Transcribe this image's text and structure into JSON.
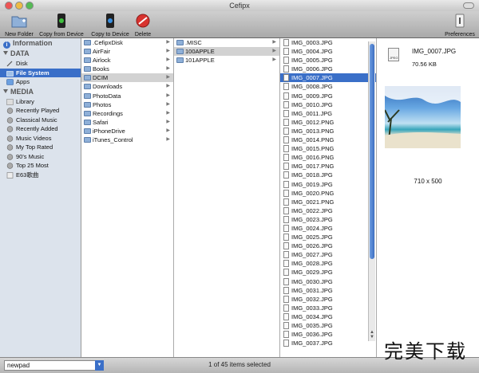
{
  "window": {
    "title": "Cefipx"
  },
  "toolbar": {
    "new_folder": "New Folder",
    "copy_from_device": "Copy from Device",
    "copy_to_device": "Copy to Device",
    "delete": "Delete",
    "preferences": "Preferences"
  },
  "sidebar": {
    "information": "Information",
    "data_header": "DATA",
    "data_items": [
      "Disk",
      "File System",
      "Apps"
    ],
    "media_header": "MEDIA",
    "media_items": [
      "Library",
      "Recently Played",
      "Classical Music",
      "Recently Added",
      "Music Videos",
      "My Top Rated",
      "90's Music",
      "Top 25 Most",
      "E63歌曲"
    ]
  },
  "columns": {
    "col1": [
      ".CefipxDisk",
      "AirFair",
      "Airlock",
      "Books",
      "DCIM",
      "Downloads",
      "PhotoData",
      "Photos",
      "Recordings",
      "Safari",
      "iPhoneDrive",
      "iTunes_Control"
    ],
    "col2": [
      ".MISC",
      "100APPLE",
      "101APPLE"
    ],
    "col3": [
      "IMG_0003.JPG",
      "IMG_0004.JPG",
      "IMG_0005.JPG",
      "IMG_0006.JPG",
      "IMG_0007.JPG",
      "IMG_0008.JPG",
      "IMG_0009.JPG",
      "IMG_0010.JPG",
      "IMG_0011.JPG",
      "IMG_0012.PNG",
      "IMG_0013.PNG",
      "IMG_0014.PNG",
      "IMG_0015.PNG",
      "IMG_0016.PNG",
      "IMG_0017.PNG",
      "IMG_0018.JPG",
      "IMG_0019.JPG",
      "IMG_0020.PNG",
      "IMG_0021.PNG",
      "IMG_0022.JPG",
      "IMG_0023.JPG",
      "IMG_0024.JPG",
      "IMG_0025.JPG",
      "IMG_0026.JPG",
      "IMG_0027.JPG",
      "IMG_0028.JPG",
      "IMG_0029.JPG",
      "IMG_0030.JPG",
      "IMG_0031.JPG",
      "IMG_0032.JPG",
      "IMG_0033.JPG",
      "IMG_0034.JPG",
      "IMG_0035.JPG",
      "IMG_0036.JPG",
      "IMG_0037.JPG"
    ]
  },
  "preview": {
    "file_name": "IMG_0007.JPG",
    "file_size": "70.56 KB",
    "dimensions": "710 x 500",
    "file_icon_label": "JPEG"
  },
  "status": {
    "combo_value": "newpad",
    "items_text": "1 of 45 items selected"
  },
  "watermark": "完美下载",
  "colors": {
    "selection": "#3a6fc8",
    "sidebar_bg": "#dce3ec"
  }
}
